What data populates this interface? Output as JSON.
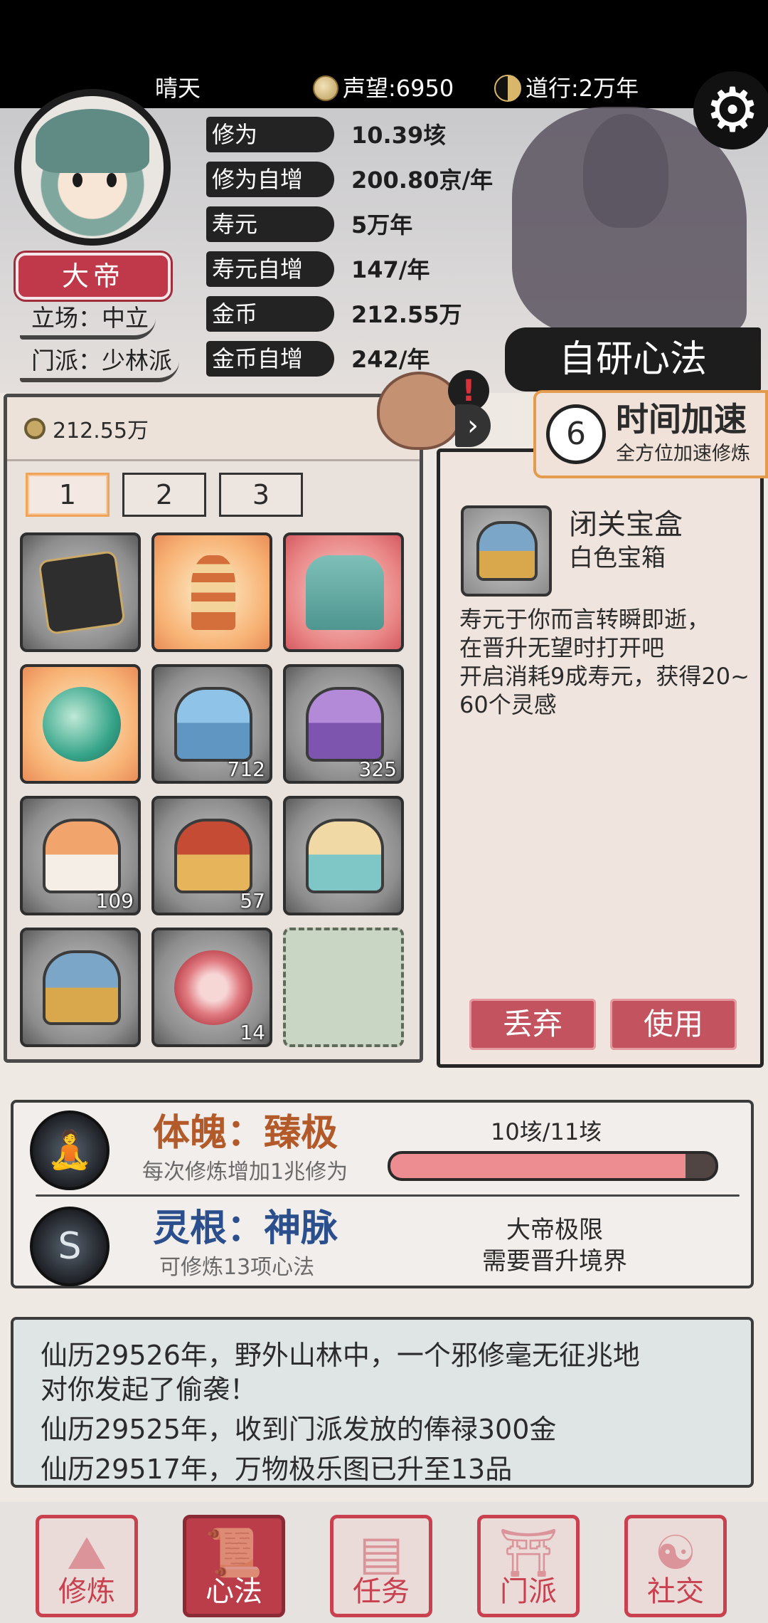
{
  "topbar": {
    "weather": "晴天",
    "reputation": "声望:6950",
    "dao": "道行:2万年"
  },
  "player": {
    "title": "大帝",
    "stance": "立场：中立",
    "sect": "门派：少林派"
  },
  "stats": [
    {
      "label": "修为",
      "value": "10.39垓"
    },
    {
      "label": "修为自增",
      "value": "200.80京/年"
    },
    {
      "label": "寿元",
      "value": "5万年"
    },
    {
      "label": "寿元自增",
      "value": "147/年"
    },
    {
      "label": "金币",
      "value": "212.55万"
    },
    {
      "label": "金币自增",
      "value": "242/年"
    }
  ],
  "self_research": "自研心法",
  "speedup": {
    "count": "6",
    "title": "时间加速",
    "subtitle": "全方位加速修炼"
  },
  "inventory": {
    "money": "212.55万",
    "pages": [
      "1",
      "2",
      "3"
    ],
    "active_page": 0,
    "slots": [
      {
        "icon": "manual-box-icon",
        "count": ""
      },
      {
        "icon": "pagoda-icon",
        "count": ""
      },
      {
        "icon": "robe-icon",
        "count": ""
      },
      {
        "icon": "jade-orb-icon",
        "count": ""
      },
      {
        "icon": "blue-chest-icon",
        "count": "712"
      },
      {
        "icon": "purple-chest-icon",
        "count": "325"
      },
      {
        "icon": "orange-chest-icon",
        "count": "109"
      },
      {
        "icon": "red-gold-chest-icon",
        "count": "57"
      },
      {
        "icon": "gold-chest-icon",
        "count": ""
      },
      {
        "icon": "seclusion-chest-icon",
        "count": ""
      },
      {
        "icon": "swirl-orb-icon",
        "count": "14"
      },
      {
        "icon": "empty-slot",
        "count": ""
      }
    ]
  },
  "detail": {
    "name": "闭关宝盒",
    "grade": "白色宝箱",
    "description": "寿元于你而言转瞬即逝，\n在晋升无望时打开吧\n开启消耗9成寿元，获得20~60个灵感",
    "discard": "丢弃",
    "use": "使用"
  },
  "physique": {
    "title": "体魄：臻极",
    "subtitle": "每次修炼增加1兆修为",
    "progress_label": "10垓/11垓",
    "progress": 0.909
  },
  "root": {
    "title": "灵根：神脉",
    "subtitle": "可修炼13项心法",
    "limit": "大帝极限\n需要晋升境界"
  },
  "log": [
    "仙历29526年，野外山林中，一个邪修毫无征兆地\n对你发起了偷袭！",
    "仙历29525年，收到门派发放的俸禄300金",
    "仙历29517年，万物极乐图已升至13品"
  ],
  "nav": [
    {
      "label": "修炼",
      "active": false
    },
    {
      "label": "心法",
      "active": true
    },
    {
      "label": "任务",
      "active": false
    },
    {
      "label": "门派",
      "active": false
    },
    {
      "label": "社交",
      "active": false
    }
  ]
}
